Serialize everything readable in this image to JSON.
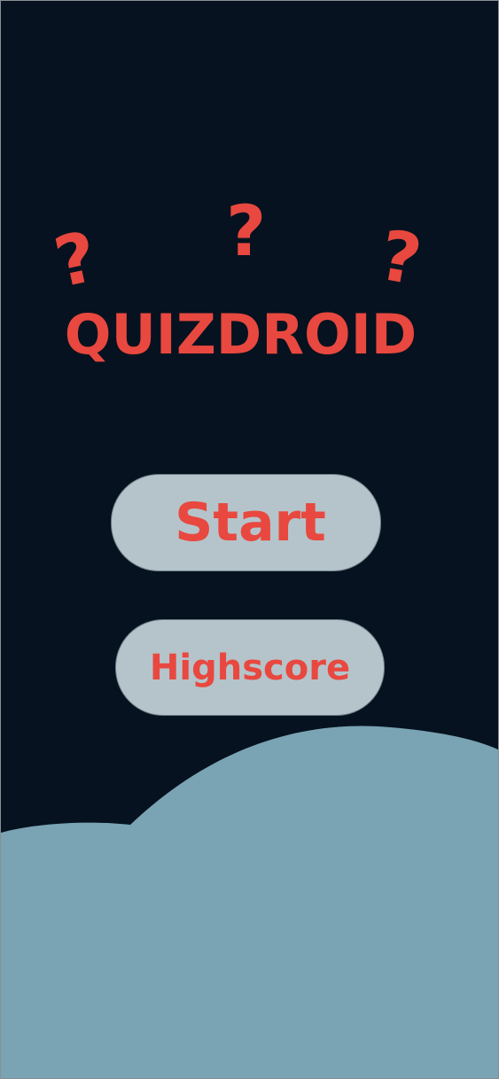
{
  "app": {
    "title": "QUIZDROID"
  },
  "decorations": {
    "question_mark": "?"
  },
  "buttons": {
    "start_label": "Start",
    "highscore_label": "Highscore"
  },
  "colors": {
    "background": "#06121f",
    "accent": "#e8483f",
    "button_fill": "#b5c4ca",
    "button_border": "#6d7d86",
    "wave": "#7aa3b4"
  }
}
